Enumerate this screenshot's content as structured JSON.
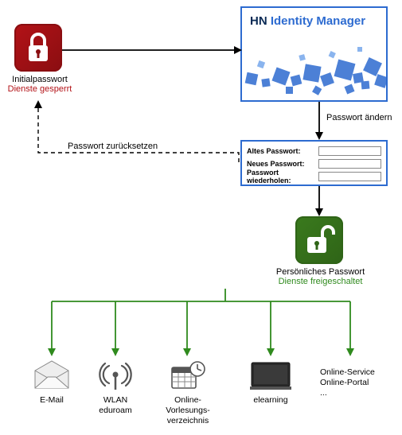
{
  "initial": {
    "label": "Initialpasswort",
    "status": "Dienste gesperrt"
  },
  "manager": {
    "hn": "HN",
    "title": "Identity Manager"
  },
  "arrows": {
    "change": "Passwort ändern",
    "reset": "Passwort zurücksetzen"
  },
  "form": {
    "old": "Altes Passwort:",
    "new": "Neues Passwort:",
    "repeat": "Passwort wiederholen:"
  },
  "personal": {
    "label": "Persönliches Passwort",
    "status": "Dienste freigeschaltet"
  },
  "services": [
    {
      "label": "E-Mail"
    },
    {
      "label": "WLAN\neduroam"
    },
    {
      "label": "Online-\nVorlesungs-\nverzeichnis"
    },
    {
      "label": "elearning"
    },
    {
      "label": "Online-Service\nOnline-Portal\n..."
    }
  ]
}
